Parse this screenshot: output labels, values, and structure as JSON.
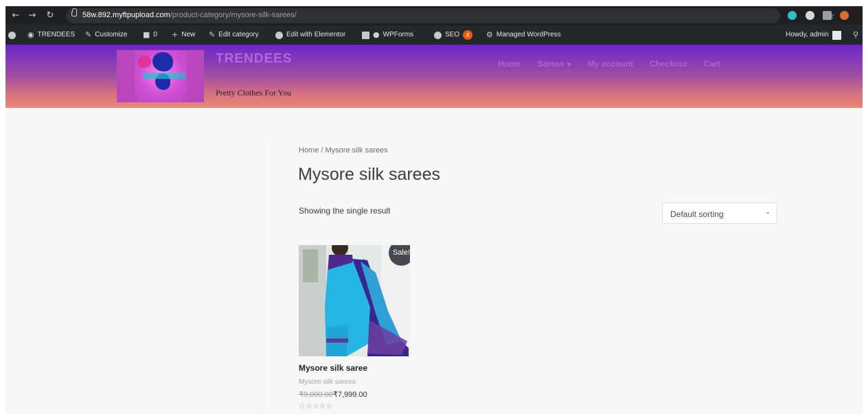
{
  "browser": {
    "url_host": "58w.892.myftpupload.com",
    "url_path": "/product-category/mysore-silk-sarees/",
    "icons": [
      "back-arrow-icon",
      "forward-arrow-icon",
      "reload-icon",
      "lock-icon",
      "bookmark-star-icon",
      "extension-icons"
    ]
  },
  "admin_bar": {
    "site_name": "TRENDEES",
    "customize": "Customize",
    "comments_count": "0",
    "new": "New",
    "edit_category": "Edit category",
    "edit_elementor": "Edit with Elementor",
    "wpforms": "WPForms",
    "seo": "SEO",
    "seo_count": "4",
    "managed": "Managed WordPress",
    "howdy": "Howdy, admin"
  },
  "site": {
    "title": "TRENDEES",
    "tagline": "Pretty Clothes For You",
    "nav": [
      "Home",
      "Sarees",
      "My account",
      "Checkout",
      "Cart"
    ]
  },
  "content": {
    "breadcrumb": "Home / Mysore silk sarees",
    "page_title": "Mysore silk sarees",
    "result_count": "Showing the single result",
    "sorting": "Default sorting"
  },
  "product": {
    "sale_badge": "Sale!",
    "name": "Mysore silk saree",
    "category": "Mysore silk sarees",
    "price_old": "₹9,000.00",
    "price_new": "₹7,999.00",
    "rating_stars": "☆☆☆☆☆",
    "rating_value": 0
  },
  "colors": {
    "header_top": "#6a27c8",
    "header_bottom": "#ea8a78",
    "nav_text": "#b85fd0",
    "admin_bar": "#23282d",
    "seo_badge": "#e8590c"
  }
}
